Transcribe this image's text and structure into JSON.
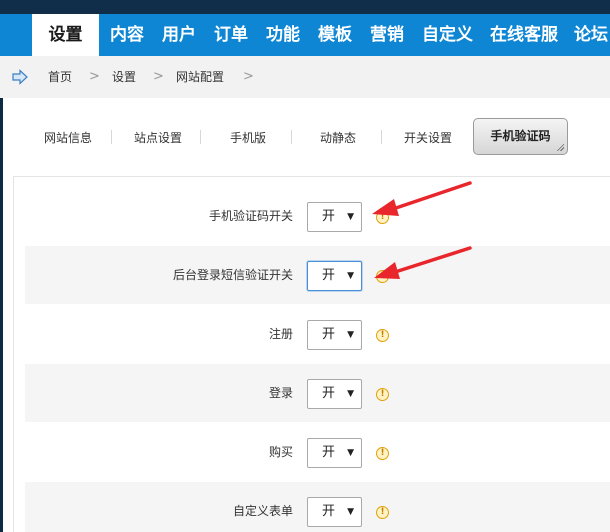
{
  "nav": {
    "items": [
      {
        "label": "设置",
        "active": true
      },
      {
        "label": "内容"
      },
      {
        "label": "用户"
      },
      {
        "label": "订单"
      },
      {
        "label": "功能"
      },
      {
        "label": "模板"
      },
      {
        "label": "营销"
      },
      {
        "label": "自定义"
      },
      {
        "label": "在线客服"
      },
      {
        "label": "论坛"
      }
    ]
  },
  "breadcrumb": {
    "icon": "home-arrow-icon",
    "items": [
      "首页",
      "设置",
      "网站配置"
    ],
    "separator": ">"
  },
  "tabs": {
    "items": [
      "网站信息",
      "站点设置",
      "手机版",
      "动静态",
      "开关设置"
    ],
    "active": "手机验证码"
  },
  "form": {
    "rows": [
      {
        "label": "手机验证码开关",
        "value": "开",
        "shaded": false
      },
      {
        "label": "后台登录短信验证开关",
        "value": "开",
        "shaded": true,
        "focused": true
      },
      {
        "label": "注册",
        "value": "开",
        "shaded": false
      },
      {
        "label": "登录",
        "value": "开",
        "shaded": true
      },
      {
        "label": "购买",
        "value": "开",
        "shaded": false
      },
      {
        "label": "自定义表单",
        "value": "开",
        "shaded": true
      }
    ],
    "info_icon": "!",
    "select_arrow": "▼"
  },
  "colors": {
    "nav_bg": "#0e86d4",
    "nav_dark": "#102d4a",
    "annotation_arrow": "#e8262b",
    "info_icon": "#e2a10e"
  }
}
